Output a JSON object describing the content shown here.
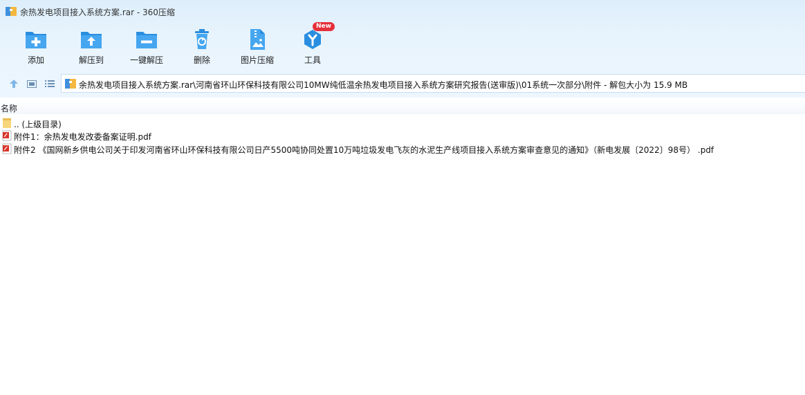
{
  "window": {
    "title": "余热发电项目接入系统方案.rar - 360压缩"
  },
  "toolbar": {
    "items": [
      {
        "label": "添加",
        "icon": "folder-add-icon"
      },
      {
        "label": "解压到",
        "icon": "folder-extract-icon"
      },
      {
        "label": "一键解压",
        "icon": "folder-minus-icon"
      },
      {
        "label": "删除",
        "icon": "trash-icon"
      },
      {
        "label": "图片压缩",
        "icon": "image-compress-icon"
      },
      {
        "label": "工具",
        "icon": "tools-icon"
      }
    ],
    "badge": "New"
  },
  "address": {
    "path": "余热发电项目接入系统方案.rar\\河南省环山环保科技有限公司10MW纯低温余热发电项目接入系统方案研究报告(送审版)\\01系统一次部分\\附件 - 解包大小为 15.9 MB"
  },
  "columns": {
    "name": "名称"
  },
  "files": [
    {
      "name": ".. (上级目录)",
      "type": "folder"
    },
    {
      "name": "附件1：余热发电发改委备案证明.pdf",
      "type": "pdf"
    },
    {
      "name": "附件2 《国网新乡供电公司关于印发河南省环山环保科技有限公司日产5500吨协同处置10万吨垃圾发电飞灰的水泥生产线项目接入系统方案审查意见的通知》（新电发展〔2022〕98号）    .pdf",
      "type": "pdf"
    }
  ],
  "colors": {
    "accent": "#2a8ee0",
    "badge": "#e5303a",
    "toolbar_bg": "#e8f4fd"
  }
}
